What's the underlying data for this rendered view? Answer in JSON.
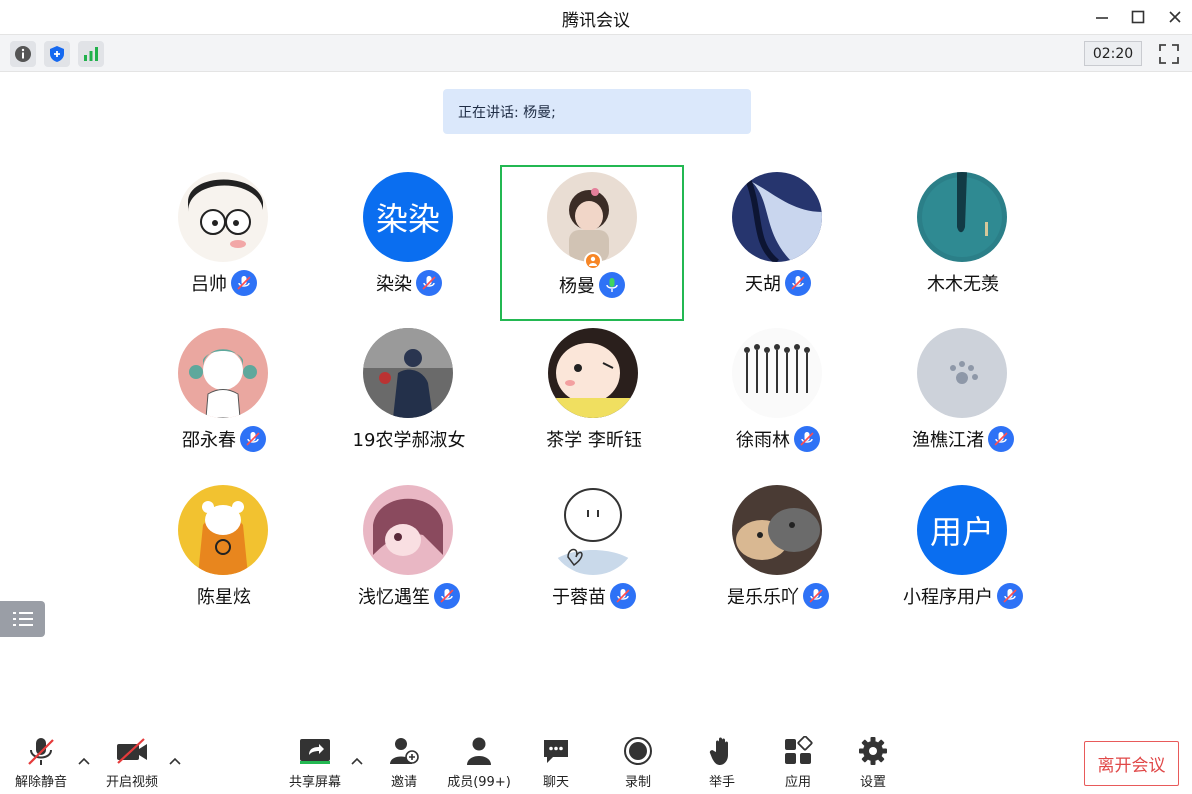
{
  "window": {
    "title": "腾讯会议"
  },
  "toolbar": {
    "timer": "02:20"
  },
  "speaking": {
    "label": "正在讲话: 杨曼;"
  },
  "participants": [
    {
      "name": "吕帅",
      "mic": "muted"
    },
    {
      "name": "染染",
      "avatar_text": "染染",
      "mic": "muted"
    },
    {
      "name": "杨曼",
      "mic": "speaking",
      "host": true
    },
    {
      "name": "天胡",
      "mic": "muted"
    },
    {
      "name": "木木无羡",
      "mic": "none"
    },
    {
      "name": "邵永春",
      "mic": "muted"
    },
    {
      "name": "19农学郝淑女",
      "mic": "none"
    },
    {
      "name": "茶学 李昕钰",
      "mic": "none"
    },
    {
      "name": "徐雨林",
      "mic": "muted"
    },
    {
      "name": "渔樵江渚",
      "mic": "muted"
    },
    {
      "name": "陈星炫",
      "mic": "none"
    },
    {
      "name": "浅忆遇笙",
      "mic": "muted"
    },
    {
      "name": "于蓉苗",
      "mic": "muted"
    },
    {
      "name": "是乐乐吖",
      "mic": "muted"
    },
    {
      "name": "小程序用户",
      "avatar_text": "用户",
      "mic": "muted"
    }
  ],
  "bottom": {
    "unmute": "解除静音",
    "video": "开启视频",
    "share": "共享屏幕",
    "invite": "邀请",
    "members": "成员(99+)",
    "chat": "聊天",
    "record": "录制",
    "raise_hand": "举手",
    "apps": "应用",
    "settings": "设置",
    "leave": "离开会议"
  },
  "colors": {
    "accent": "#0a6ef0",
    "speaking_border": "#23b852",
    "leave": "#e04848",
    "host_badge": "#f78626"
  }
}
